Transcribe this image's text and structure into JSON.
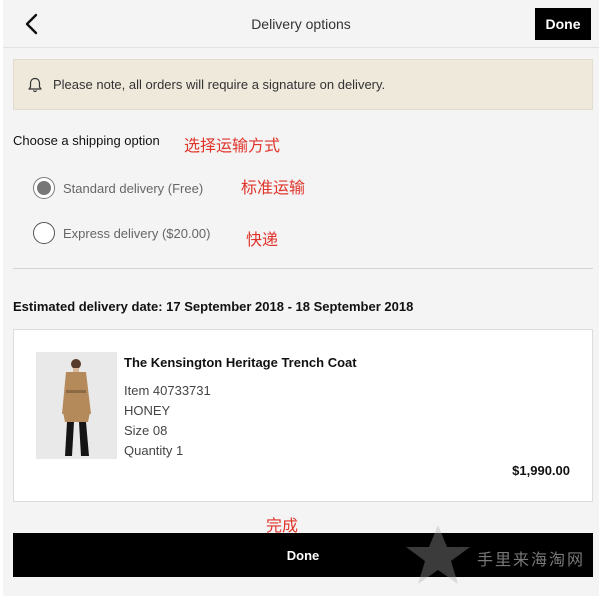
{
  "header": {
    "title": "Delivery options",
    "done_label": "Done"
  },
  "notice": {
    "text": "Please note, all orders will require a signature on delivery."
  },
  "shipping": {
    "title": "Choose a shipping option",
    "title_annotation": "选择运输方式",
    "options": [
      {
        "label": "Standard delivery (Free)",
        "selected": true,
        "annotation": "标准运输"
      },
      {
        "label": "Express delivery ($20.00)",
        "selected": false,
        "annotation": "快递"
      }
    ]
  },
  "estimated": {
    "text": "Estimated delivery date: 17 September 2018 - 18 September 2018"
  },
  "item": {
    "name": "The Kensington Heritage Trench Coat",
    "item_number": "Item 40733731",
    "color": "HONEY",
    "size": "Size 08",
    "quantity": "Quantity 1",
    "price": "$1,990.00"
  },
  "footer": {
    "done_annotation": "完成",
    "done_label": "Done",
    "watermark": "手里来海淘网"
  },
  "colors": {
    "notice_bg": "#efe9db",
    "button_bg": "#000000",
    "annotation": "#e0342b"
  }
}
